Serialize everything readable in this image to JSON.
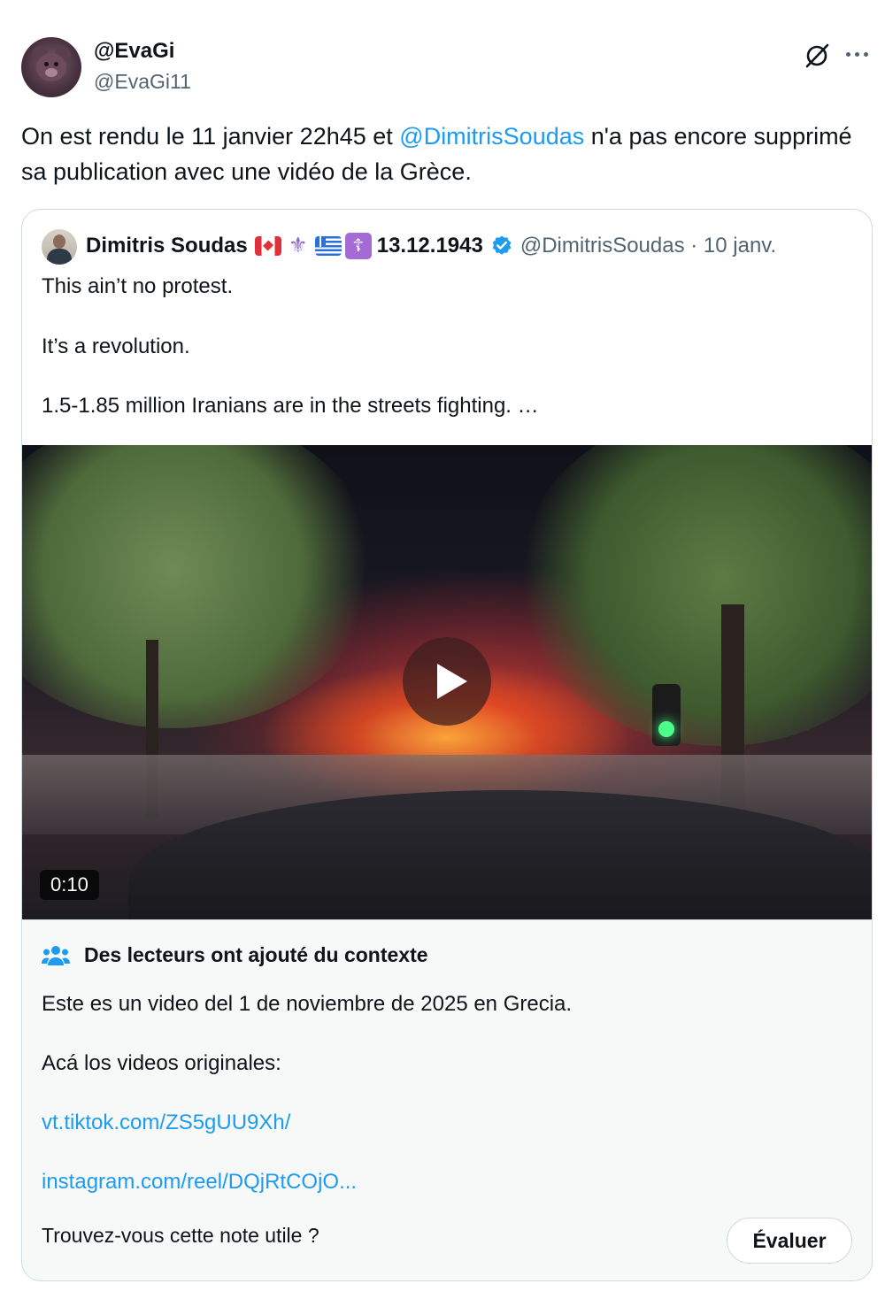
{
  "author": {
    "display_name": "@EvaGi",
    "handle": "@EvaGi11"
  },
  "tweet": {
    "text_before": "On est rendu le 11 janvier 22h45 et ",
    "mention": "@DimitrisSoudas",
    "text_after": " n'a pas encore supprimé sa publication avec une vidéo de la Grèce."
  },
  "icons": {
    "grok": "grok-icon",
    "more": "more-icon",
    "verified": "verified-badge-icon",
    "note": "people-icon",
    "play": "play-icon"
  },
  "quote": {
    "display_name": "Dimitris Soudas",
    "name_tag": "13.12.1943",
    "handle_date": "@DimitrisSoudas · 10 janv.",
    "paragraphs": [
      "This ain’t no protest.",
      "It’s a revolution.",
      "1.5-1.85 million Iranians are in the streets fighting. …"
    ],
    "video": {
      "duration": "0:10"
    }
  },
  "note": {
    "title": "Des lecteurs ont ajouté du contexte",
    "body": "Este es un video del 1 de noviembre de 2025 en Grecia.",
    "intro": "Acá los videos originales:",
    "links": [
      "vt.tiktok.com/ZS5gUU9Xh/",
      "instagram.com/reel/DQjRtCOjO..."
    ],
    "question": "Trouvez-vous cette note utile ?",
    "rate_label": "Évaluer"
  },
  "colors": {
    "link": "#1d9bf0",
    "text": "#0f1419",
    "secondary": "#536471",
    "border": "#cfd9de",
    "note_bg": "#f7f9f9",
    "verified": "#1d9bf0"
  }
}
